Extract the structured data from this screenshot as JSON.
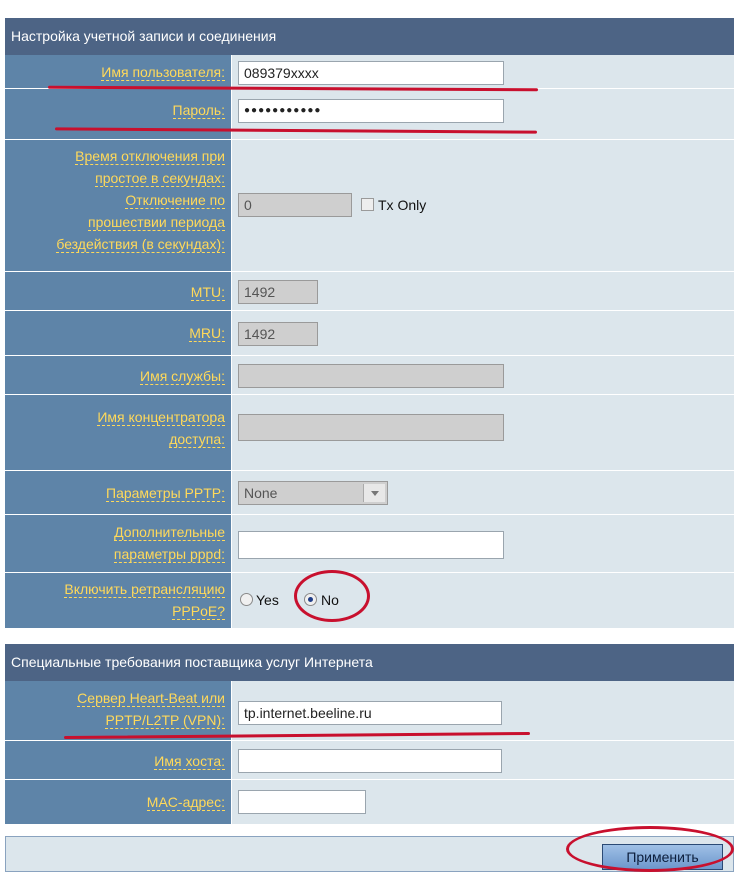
{
  "section1": {
    "title": "Настройка учетной записи и соединения",
    "username": {
      "label": "Имя пользователя:",
      "value": "089379xxxx"
    },
    "password": {
      "label": "Пароль:",
      "value": "●●●●●●●●●●●"
    },
    "idle_time": {
      "label_lines": [
        "Время отключения при",
        "простое в секундах:",
        "Отключение по",
        "прошествии периода",
        "бездействия (в секундах):"
      ],
      "value": "0",
      "tx_only_label": "Tx Only",
      "tx_only_checked": false
    },
    "mtu": {
      "label": "MTU:",
      "value": "1492"
    },
    "mru": {
      "label": "MRU:",
      "value": "1492"
    },
    "service_name": {
      "label": "Имя службы:",
      "value": ""
    },
    "ac_name": {
      "label_lines": [
        "Имя концентратора",
        "доступа:"
      ],
      "value": ""
    },
    "pptp_options": {
      "label": "Параметры PPTP:",
      "selected": "None"
    },
    "pppd_options": {
      "label_lines": [
        "Дополнительные",
        "параметры pppd:"
      ],
      "value": ""
    },
    "pppoe_relay": {
      "label_lines": [
        "Включить ретрансляцию",
        "PPPoE?"
      ],
      "option_yes": "Yes",
      "option_no": "No",
      "selected": "No"
    }
  },
  "section2": {
    "title": "Специальные требования поставщика услуг Интернета",
    "heartbeat_server": {
      "label_lines": [
        "Сервер Heart-Beat или",
        "PPTP/L2TP (VPN):"
      ],
      "value": "tp.internet.beeline.ru"
    },
    "hostname": {
      "label": "Имя хоста:",
      "value": ""
    },
    "mac_address": {
      "label": "MAC-адрес:",
      "value": ""
    }
  },
  "apply_button": "Применить",
  "colors": {
    "header_bg": "#4d6485",
    "label_bg": "#5e84a8",
    "label_text": "#ffd95a",
    "value_bg": "#dce6ec",
    "annotation": "#c8102e"
  }
}
